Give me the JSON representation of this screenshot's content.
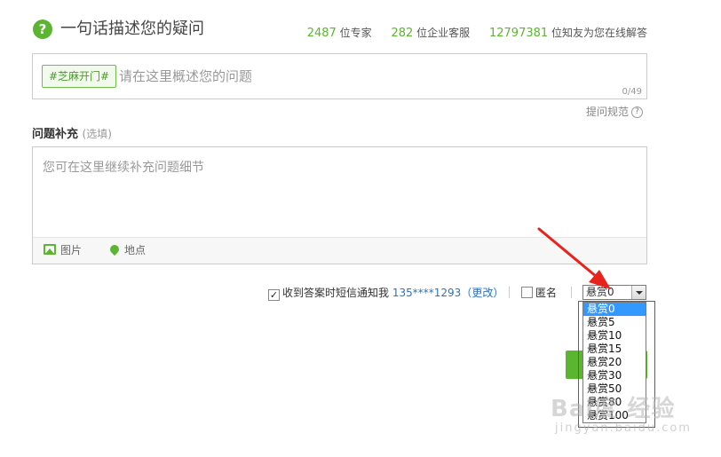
{
  "header": {
    "icon": "question-circle-icon",
    "title": "一句话描述您的疑问",
    "experts_count": "2487",
    "experts_label": "位专家",
    "service_count": "282",
    "service_label": "位企业客服",
    "friends_count": "12797381",
    "friends_label": "位知友为您在线解答"
  },
  "question": {
    "tag_button": "#芝麻开门#",
    "placeholder": "请在这里概述您的问题",
    "counter": "0/49"
  },
  "rules_link": "提问规范",
  "supplement": {
    "label": "问题补充",
    "optional": "(选填)",
    "placeholder": "您可在这里继续补充问题细节",
    "image_tool": "图片",
    "location_tool": "地点"
  },
  "options": {
    "sms_label": "收到答案时短信通知我",
    "sms_checked": true,
    "phone": "135****1293",
    "change_open": "（",
    "change_link": "更改",
    "change_close": "）",
    "anonymous_label": "匿名",
    "anonymous_checked": false
  },
  "reward": {
    "selected": "悬赏0",
    "options": [
      "悬赏0",
      "悬赏5",
      "悬赏10",
      "悬赏15",
      "悬赏20",
      "悬赏30",
      "悬赏50",
      "悬赏80",
      "悬赏100"
    ]
  },
  "watermark": {
    "logo_text": "Bai度 经验",
    "url_text": "jingyan.baidu.com"
  },
  "colors": {
    "accent_green": "#5cb531",
    "link_blue": "#2e73b8",
    "arrow_red": "#e8231e",
    "highlight_red": "#c0392b"
  }
}
